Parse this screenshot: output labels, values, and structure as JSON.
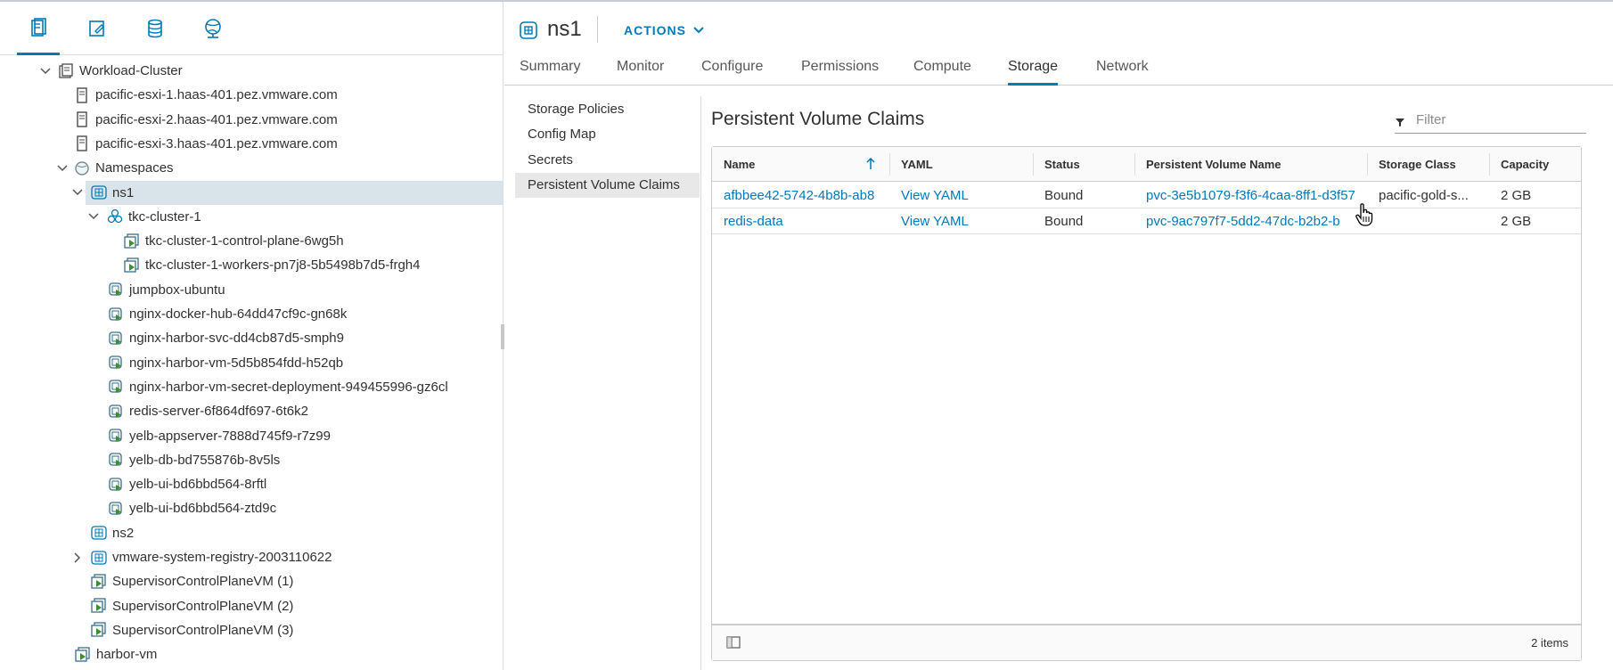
{
  "left_tabs": [
    {
      "icon": "hosts-clusters-icon",
      "active": true
    },
    {
      "icon": "vms-templates-icon",
      "active": false
    },
    {
      "icon": "storage-icon",
      "active": false
    },
    {
      "icon": "networking-icon",
      "active": false
    }
  ],
  "tree": [
    {
      "label": "Workload-Cluster",
      "icon": "cluster-icon",
      "caret": "down"
    },
    {
      "label": "pacific-esxi-1.haas-401.pez.vmware.com",
      "icon": "host-icon"
    },
    {
      "label": "pacific-esxi-2.haas-401.pez.vmware.com",
      "icon": "host-icon"
    },
    {
      "label": "pacific-esxi-3.haas-401.pez.vmware.com",
      "icon": "host-icon"
    },
    {
      "label": "Namespaces",
      "icon": "namespaces-icon",
      "caret": "down"
    },
    {
      "label": "ns1",
      "icon": "namespace-icon",
      "caret": "down",
      "selected": true
    },
    {
      "label": "tkc-cluster-1",
      "icon": "tkc-icon",
      "caret": "down"
    },
    {
      "label": "tkc-cluster-1-control-plane-6wg5h",
      "icon": "vm-icon"
    },
    {
      "label": "tkc-cluster-1-workers-pn7j8-5b5498b7d5-frgh4",
      "icon": "vm-icon"
    },
    {
      "label": "jumpbox-ubuntu",
      "icon": "pod-icon"
    },
    {
      "label": "nginx-docker-hub-64dd47cf9c-gn68k",
      "icon": "pod-icon"
    },
    {
      "label": "nginx-harbor-svc-dd4cb87d5-smph9",
      "icon": "pod-icon"
    },
    {
      "label": "nginx-harbor-vm-5d5b854fdd-h52qb",
      "icon": "pod-icon"
    },
    {
      "label": "nginx-harbor-vm-secret-deployment-949455996-gz6cl",
      "icon": "pod-icon"
    },
    {
      "label": "redis-server-6f864df697-6t6k2",
      "icon": "pod-icon"
    },
    {
      "label": "yelb-appserver-7888d745f9-r7z99",
      "icon": "pod-icon"
    },
    {
      "label": "yelb-db-bd755876b-8v5ls",
      "icon": "pod-icon"
    },
    {
      "label": "yelb-ui-bd6bbd564-8rftl",
      "icon": "pod-icon"
    },
    {
      "label": "yelb-ui-bd6bbd564-ztd9c",
      "icon": "pod-icon"
    },
    {
      "label": "ns2",
      "icon": "namespace-icon"
    },
    {
      "label": "vmware-system-registry-2003110622",
      "icon": "namespace-icon",
      "caret": "right"
    },
    {
      "label": "SupervisorControlPlaneVM (1)",
      "icon": "vm-icon"
    },
    {
      "label": "SupervisorControlPlaneVM (2)",
      "icon": "vm-icon"
    },
    {
      "label": "SupervisorControlPlaneVM (3)",
      "icon": "vm-icon"
    },
    {
      "label": "harbor-vm",
      "icon": "vm-icon"
    }
  ],
  "header": {
    "title": "ns1",
    "actions_label": "ACTIONS"
  },
  "tabs": [
    "Summary",
    "Monitor",
    "Configure",
    "Permissions",
    "Compute",
    "Storage",
    "Network"
  ],
  "active_tab": "Storage",
  "subnav": [
    "Storage Policies",
    "Config Map",
    "Secrets",
    "Persistent Volume Claims"
  ],
  "active_subnav": "Persistent Volume Claims",
  "pvc": {
    "title": "Persistent Volume Claims",
    "filter_placeholder": "Filter",
    "columns": [
      "Name",
      "YAML",
      "Status",
      "Persistent Volume Name",
      "Storage Class",
      "Capacity"
    ],
    "rows": [
      {
        "name": "afbbee42-5742-4b8b-ab8",
        "yaml": "View YAML",
        "status": "Bound",
        "pv_name": "pvc-3e5b1079-f3f6-4caa-8ff1-d3f57",
        "storage_class": "pacific-gold-s...",
        "capacity": "2 GB"
      },
      {
        "name": "redis-data",
        "yaml": "View YAML",
        "status": "Bound",
        "pv_name": "pvc-9ac797f7-5dd2-47dc-b2b2-b",
        "storage_class": "",
        "capacity": "2 GB"
      }
    ],
    "item_count": "2 items"
  },
  "colors": {
    "accent": "#0079b8",
    "selected_row": "#d9e4ea",
    "vm_green": "#3c8f2f"
  }
}
